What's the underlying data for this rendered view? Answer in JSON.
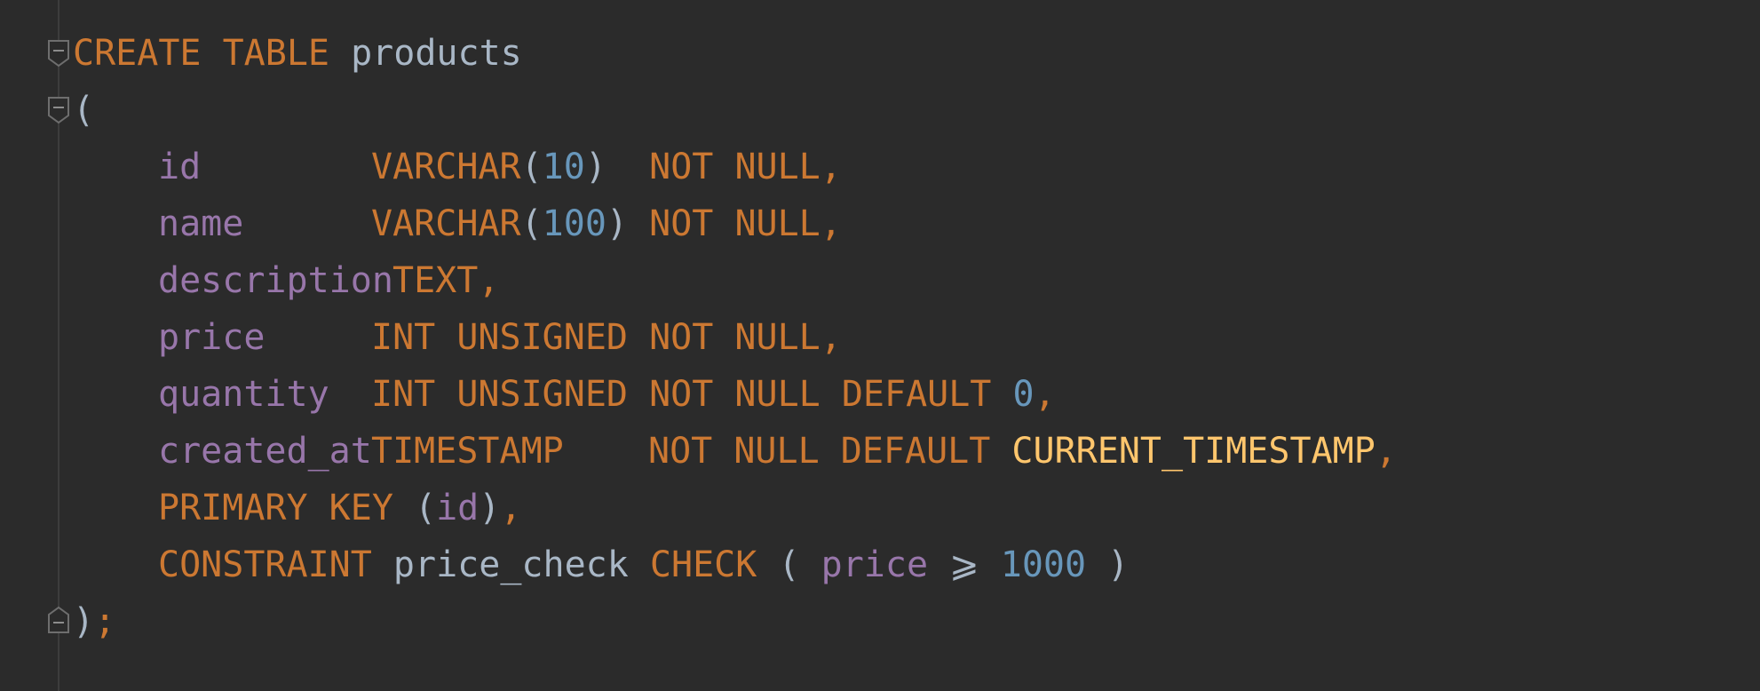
{
  "editor": {
    "lines": {
      "l1": {
        "kw": "CREATE TABLE",
        "name": "products"
      },
      "l2": {
        "open": "("
      },
      "l3": {
        "col": "id",
        "type": "VARCHAR",
        "lp": "(",
        "size": "10",
        "rp": ")",
        "constraint": "NOT NULL",
        "comma": ","
      },
      "l4": {
        "col": "name",
        "type": "VARCHAR",
        "lp": "(",
        "size": "100",
        "rp": ")",
        "constraint": "NOT NULL",
        "comma": ","
      },
      "l5": {
        "col": "description",
        "type": "TEXT",
        "comma": ","
      },
      "l6": {
        "col": "price",
        "type": "INT UNSIGNED",
        "constraint": "NOT NULL",
        "comma": ","
      },
      "l7": {
        "col": "quantity",
        "type": "INT UNSIGNED",
        "constraint": "NOT NULL DEFAULT",
        "value": "0",
        "comma": ","
      },
      "l8": {
        "col": "created_at",
        "type": "TIMESTAMP",
        "constraint": "NOT NULL DEFAULT",
        "fn": "CURRENT_TIMESTAMP",
        "comma": ","
      },
      "l9": {
        "kw": "PRIMARY KEY",
        "lp": "(",
        "col": "id",
        "rp": ")",
        "comma": ","
      },
      "l10": {
        "kw": "CONSTRAINT",
        "name": "price_check",
        "check": "CHECK",
        "lp": "(",
        "col": "price",
        "op": "⩾",
        "value": "1000",
        "rp": ")"
      },
      "l11": {
        "close": ")",
        "semi": ";"
      }
    },
    "colors": {
      "background": "#2b2b2b",
      "keyword": "#cc7832",
      "identifier": "#a9b7c6",
      "column": "#9876aa",
      "number": "#6897bb",
      "function": "#ffc66d"
    }
  }
}
